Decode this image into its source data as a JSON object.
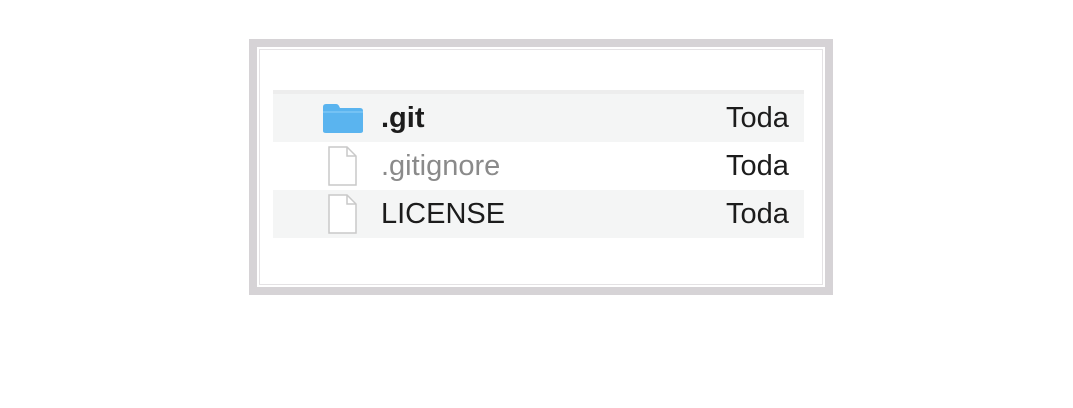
{
  "files": [
    {
      "name": ".git",
      "date": "Toda",
      "icon": "folder-icon",
      "kind": "folder",
      "dimmed": false
    },
    {
      "name": ".gitignore",
      "date": "Toda",
      "icon": "document-icon",
      "kind": "file",
      "dimmed": true
    },
    {
      "name": "LICENSE",
      "date": "Toda",
      "icon": "document-icon",
      "kind": "file",
      "dimmed": false
    }
  ],
  "colors": {
    "folder": "#5ab4ef",
    "row_alt": "#f4f5f5",
    "frame": "#d6d3d6",
    "dimmed_text": "#8a8a8a"
  }
}
